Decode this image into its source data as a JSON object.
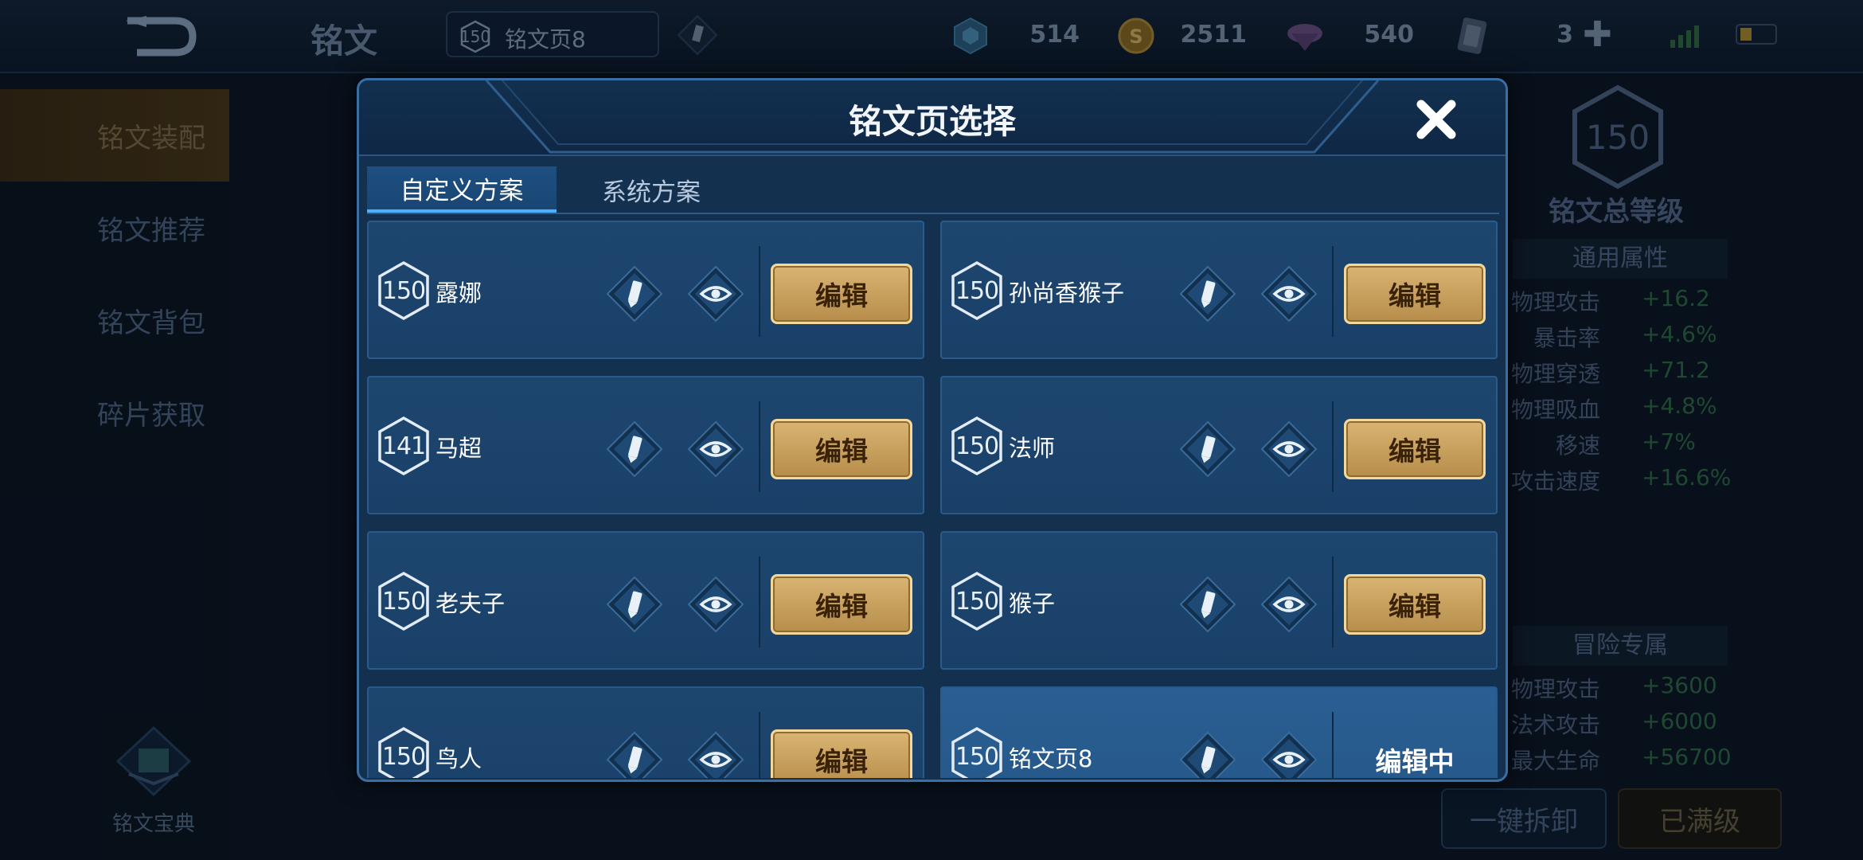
{
  "topbar": {
    "title": "铭文",
    "current_page": {
      "level": "150",
      "name": "铭文页8"
    },
    "currencies": [
      {
        "icon": "crystal-icon",
        "value": "514"
      },
      {
        "icon": "gold-coin-icon",
        "value": "2511"
      },
      {
        "icon": "diamond-icon",
        "value": "540"
      },
      {
        "icon": "card-icon",
        "value": "3"
      }
    ]
  },
  "sidebar": {
    "items": [
      {
        "label": "铭文装配"
      },
      {
        "label": "铭文推荐"
      },
      {
        "label": "铭文背包"
      },
      {
        "label": "碎片获取"
      }
    ],
    "codex_label": "铭文宝典"
  },
  "right_panel": {
    "total_level": "150",
    "total_label": "铭文总等级",
    "general_title": "通用属性",
    "general_stats": [
      {
        "k": "物理攻击",
        "v": "+16.2"
      },
      {
        "k": "暴击率",
        "v": "+4.6%"
      },
      {
        "k": "物理穿透",
        "v": "+71.2"
      },
      {
        "k": "物理吸血",
        "v": "+4.8%"
      },
      {
        "k": "移速",
        "v": "+7%"
      },
      {
        "k": "攻击速度",
        "v": "+16.6%"
      }
    ],
    "adventure_title": "冒险专属",
    "adventure_stats": [
      {
        "k": "物理攻击",
        "v": "+3600"
      },
      {
        "k": "法术攻击",
        "v": "+6000"
      },
      {
        "k": "最大生命",
        "v": "+56700"
      }
    ],
    "unload_label": "一键拆卸",
    "full_label": "已满级"
  },
  "modal": {
    "title": "铭文页选择",
    "tabs": [
      {
        "label": "自定义方案"
      },
      {
        "label": "系统方案"
      }
    ],
    "edit_label": "编辑",
    "editing_label": "编辑中",
    "pages": [
      {
        "level": "150",
        "name": "露娜"
      },
      {
        "level": "150",
        "name": "孙尚香猴子"
      },
      {
        "level": "141",
        "name": "马超"
      },
      {
        "level": "150",
        "name": "法师"
      },
      {
        "level": "150",
        "name": "老夫子"
      },
      {
        "level": "150",
        "name": "猴子"
      },
      {
        "level": "150",
        "name": "鸟人"
      },
      {
        "level": "150",
        "name": "铭文页8"
      }
    ]
  }
}
